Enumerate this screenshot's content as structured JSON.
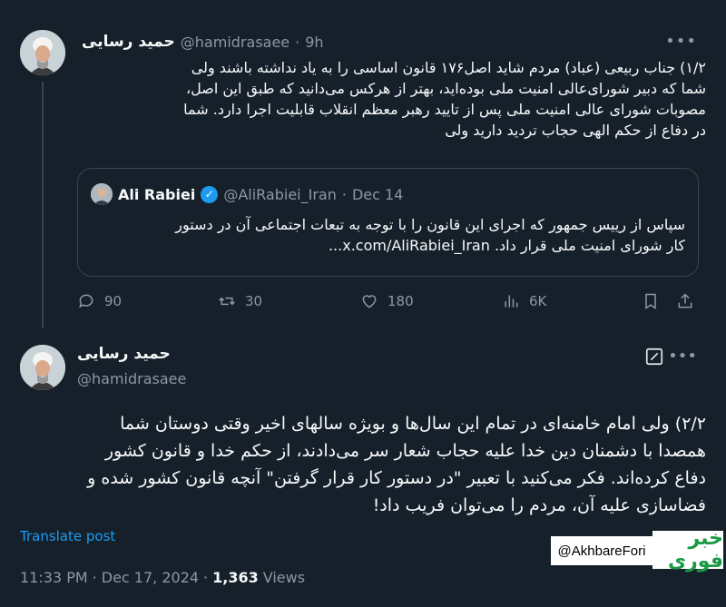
{
  "tweet1": {
    "name": "حمید رسایی",
    "handle": "@hamidrasaee",
    "time": "9h",
    "text": "۱/۲) جناب ربیعی (عباد) مردم شاید اصل۱۷۶ قانون اساسی را به یاد نداشته باشند ولی\nشما که دبیر شورای‌عالی امنیت ملی بوده‌اید، بهتر از هرکس می‌دانید که طبق این اصل،\nمصوبات شورای عالی امنیت ملی پس از تایید رهبر معظم انقلاب قابلیت اجرا دارد. شما\nدر دفاع از حکم الهی حجاب تردید دارید ولی",
    "quote": {
      "name": "Ali Rabiei",
      "handle": "@AliRabiei_Iran",
      "date": "Dec 14",
      "text": "سپاس از رییس جمهور که اجرای این قانون را با توجه به تبعات اجتماعی آن در دستور\nکار شورای امنیت ملی قرار داد. x.com/AliRabiei_Iran..."
    },
    "actions": {
      "replies": "90",
      "reposts": "30",
      "likes": "180",
      "views": "6K"
    }
  },
  "tweet2": {
    "name": "حمید رسایی",
    "handle": "@hamidrasaee",
    "text": "۲/۲) ولی امام خامنه‌ای در تمام این سال‌ها و بویژه سالهای اخیر وقتی دوستان شما\nهمصدا با دشمنان دین خدا علیه حجاب شعار سر می‌دادند، از حکم خدا و قانون کشور\nدفاع کرده‌اند. فکر می‌کنید با تعبیر \"در دستور کار قرار گرفتن\" آنچه قانون کشور شده و\nفضاسازی علیه آن، مردم را می‌توان فریب داد!",
    "translate_label": "Translate post",
    "time": "11:33 PM",
    "date": "Dec 17, 2024",
    "views_count": "1,363",
    "views_label": "Views"
  },
  "watermark": {
    "handle": "@AkhbareFori",
    "logo_text": "خبر فوری"
  }
}
